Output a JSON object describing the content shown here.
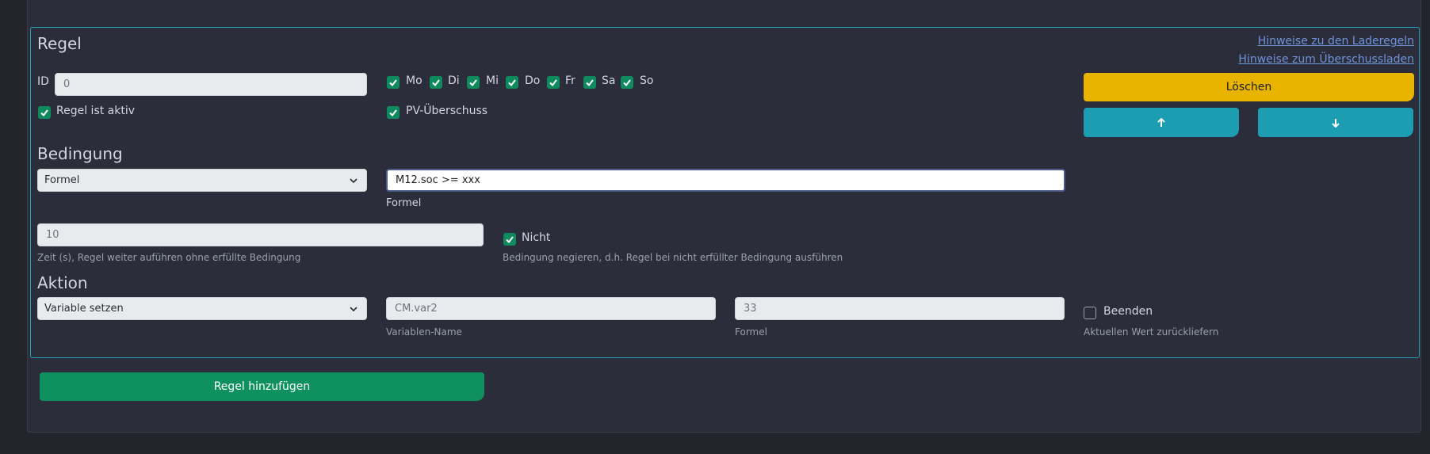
{
  "rule": {
    "title": "Regel",
    "links": {
      "charging_rules": "Hinweise zu den Laderegeln",
      "surplus_charging": "Hinweise zum Überschussladen"
    },
    "id_label": "ID",
    "id_value": "0",
    "days": [
      {
        "label": "Mo",
        "checked": true
      },
      {
        "label": "Di",
        "checked": true
      },
      {
        "label": "Mi",
        "checked": true
      },
      {
        "label": "Do",
        "checked": true
      },
      {
        "label": "Fr",
        "checked": true
      },
      {
        "label": "Sa",
        "checked": true
      },
      {
        "label": "So",
        "checked": true
      }
    ],
    "active_label": "Regel ist aktiv",
    "pv_label": "PV-Überschuss",
    "delete_label": "Löschen",
    "condition": {
      "title": "Bedingung",
      "type_value": "Formel",
      "formula_value": "M12.soc >= xxx",
      "formula_caption": "Formel",
      "time_value": "10",
      "time_caption": "Zeit (s), Regel weiter auführen ohne erfüllte Bedingung",
      "not_label": "Nicht",
      "not_caption": "Bedingung negieren, d.h. Regel bei nicht erfüllter Bedingung ausführen"
    },
    "action": {
      "title": "Aktion",
      "type_value": "Variable setzen",
      "var_name_value": "CM.var2",
      "var_name_caption": "Variablen-Name",
      "formula_value": "33",
      "formula_caption": "Formel",
      "finish_label": "Beenden",
      "finish_caption": "Aktuellen Wert zurückliefern"
    }
  },
  "add_rule_label": "Regel hinzufügen",
  "colors": {
    "accent_teal": "#1c9db1",
    "delete_yellow": "#e8b400",
    "add_green": "#0f915f",
    "checkbox_green": "#0f8a5f"
  }
}
